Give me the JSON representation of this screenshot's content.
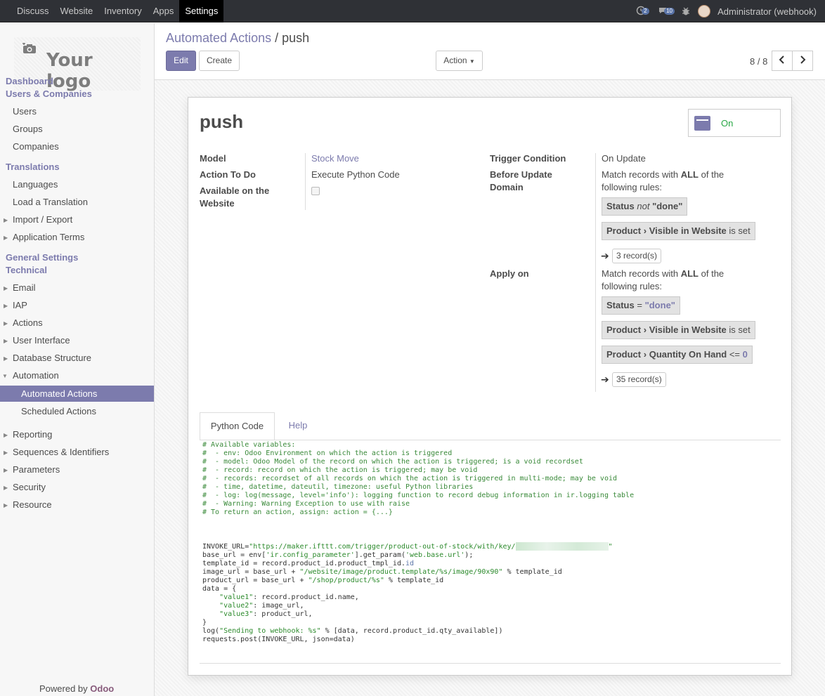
{
  "topbar": {
    "menu": [
      "Discuss",
      "Website",
      "Inventory",
      "Apps",
      "Settings"
    ],
    "active": "Settings",
    "activity_count": "2",
    "messages_count": "10",
    "user": "Administrator (webhook)"
  },
  "sidebar": {
    "logo_text": "Your logo",
    "dashboard": "Dashboard",
    "users_companies": "Users & Companies",
    "users": "Users",
    "groups": "Groups",
    "companies": "Companies",
    "translations": "Translations",
    "languages": "Languages",
    "load_translation": "Load a Translation",
    "import_export": "Import / Export",
    "app_terms": "Application Terms",
    "general_settings": "General Settings",
    "technical": "Technical",
    "email": "Email",
    "iap": "IAP",
    "actions": "Actions",
    "user_interface": "User Interface",
    "database_structure": "Database Structure",
    "automation": "Automation",
    "automated_actions": "Automated Actions",
    "scheduled_actions": "Scheduled Actions",
    "reporting": "Reporting",
    "sequences": "Sequences & Identifiers",
    "parameters": "Parameters",
    "security": "Security",
    "resource": "Resource",
    "powered_by": "Powered by",
    "odoo": "Odoo"
  },
  "control": {
    "breadcrumb_parent": "Automated Actions",
    "breadcrumb_sep": "/",
    "breadcrumb_current": "push",
    "edit": "Edit",
    "create": "Create",
    "action": "Action",
    "pager": "8 / 8"
  },
  "record": {
    "name": "push",
    "toggle_label": "On",
    "model_label": "Model",
    "model_value": "Stock Move",
    "action_label": "Action To Do",
    "action_value": "Execute Python Code",
    "website_label_1": "Available on the",
    "website_label_2": "Website",
    "trigger_label": "Trigger Condition",
    "trigger_value": "On Update",
    "before_label_1": "Before Update",
    "before_label_2": "Domain",
    "match_1": "Match records with",
    "match_all": "ALL",
    "match_2": "of the",
    "match_3": "following rules:",
    "before_rules": {
      "r1_field": "Status",
      "r1_op": "not",
      "r1_val": "\"done\"",
      "r2_field": "Product",
      "r2_sub": "Visible in Website",
      "r2_op": "is set"
    },
    "before_count": "3 record(s)",
    "apply_label": "Apply on",
    "apply_rules": {
      "r1_field": "Status",
      "r1_op": "=",
      "r1_val": "\"done\"",
      "r2_field": "Product",
      "r2_sub": "Visible in Website",
      "r2_op": "is set",
      "r3_field": "Product",
      "r3_sub": "Quantity On Hand",
      "r3_op": "<=",
      "r3_val": "0"
    },
    "apply_count": "35 record(s)"
  },
  "tabs": {
    "python_code": "Python Code",
    "help": "Help"
  },
  "code": {
    "l1": "# Available variables:",
    "l2": "#  - env: Odoo Environment on which the action is triggered",
    "l3": "#  - model: Odoo Model of the record on which the action is triggered; is a void recordset",
    "l4": "#  - record: record on which the action is triggered; may be void",
    "l5": "#  - records: recordset of all records on which the action is triggered in multi-mode; may be void",
    "l6": "#  - time, datetime, dateutil, timezone: useful Python libraries",
    "l7": "#  - log: log(message, level='info'): logging function to record debug information in ir.logging table",
    "l8": "#  - Warning: Warning Exception to use with raise",
    "l9": "# To return an action, assign: action = {...}",
    "invoke_var": "INVOKE_URL=",
    "invoke_str": "\"https://maker.ifttt.com/trigger/product-out-of-stock/with/key/",
    "invoke_end": "\"",
    "base_1": "base_url = env[",
    "base_s1": "'ir.config_parameter'",
    "base_2": "].get_param(",
    "base_s2": "'web.base.url'",
    "base_3": ");",
    "tmpl_1": "template_id = record.product_id.product_tmpl_id.",
    "tmpl_id": "id",
    "img_1": "image_url = base_url + ",
    "img_s": "\"/website/image/product.template/%s/image/90x90\"",
    "img_2": " % template_id",
    "prod_1": "product_url = base_url + ",
    "prod_s": "\"/shop/product/%s\"",
    "prod_2": " % template_id",
    "data_open": "data = {",
    "v1_k": "\"value1\"",
    "v1_v": ": record.product_id.name,",
    "v2_k": "\"value2\"",
    "v2_v": ": image_url,",
    "v3_k": "\"value3\"",
    "v3_v": ": product_url,",
    "data_close": "}",
    "log_1": "log(",
    "log_s": "\"Sending to webhook: %s\"",
    "log_2": " % [data, record.product_id.qty_available])",
    "post": "requests.post(INVOKE_URL, json=data)"
  }
}
